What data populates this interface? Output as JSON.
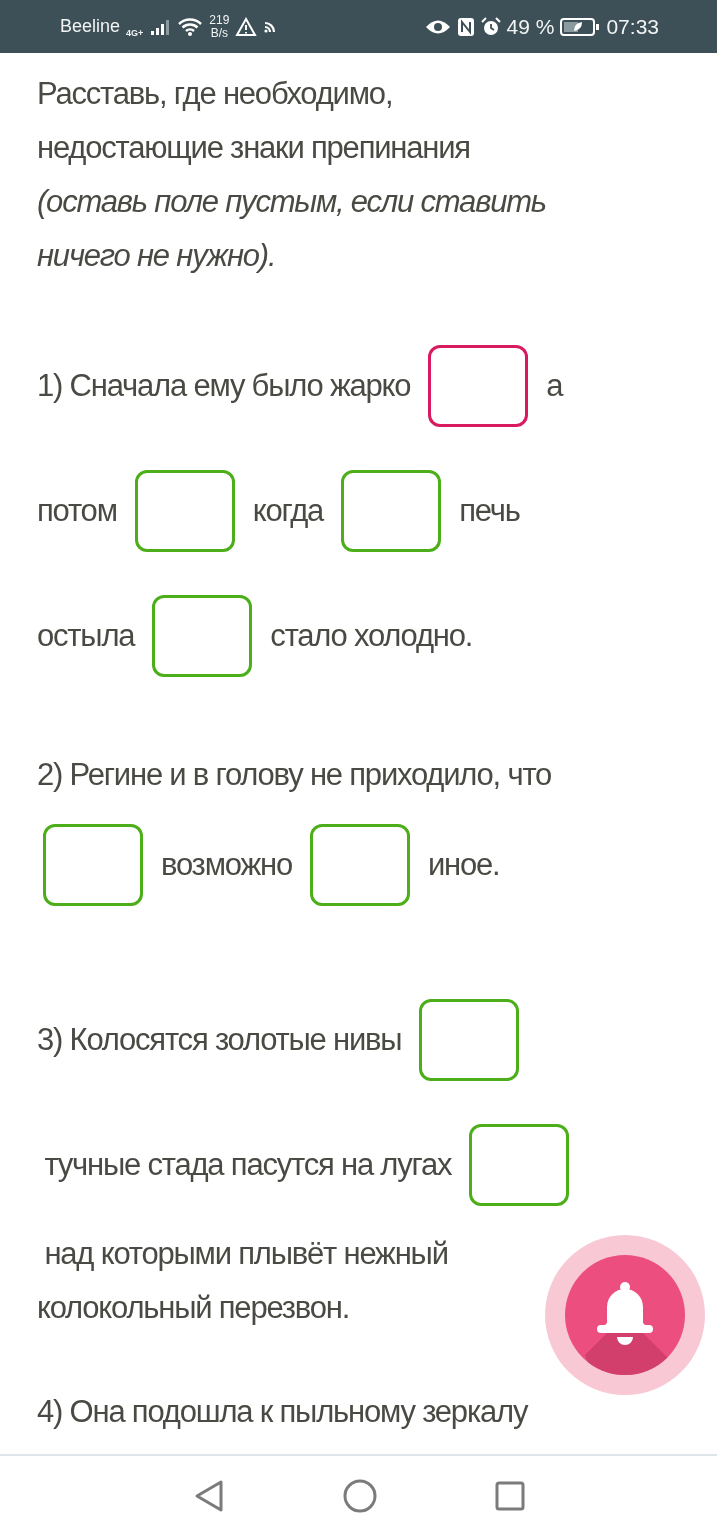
{
  "status_bar": {
    "carrier": "Beeline",
    "network": "4G+",
    "speed_value": "219",
    "speed_unit": "B/s",
    "battery": "49 %",
    "time": "07:33"
  },
  "instruction": {
    "text": "Расставь, где необходимо, недостающие знаки препинания",
    "note": "(оставь поле пустым, если ставить ничего не нужно)."
  },
  "questions": [
    {
      "lines": [
        [
          {
            "kind": "text",
            "text": "1) Сначала ему было жарко"
          },
          {
            "kind": "blank",
            "selected": true
          },
          {
            "kind": "text",
            "text": "а"
          }
        ],
        [
          {
            "kind": "text",
            "text": "потом"
          },
          {
            "kind": "blank",
            "selected": false
          },
          {
            "kind": "text",
            "text": "когда"
          },
          {
            "kind": "blank",
            "selected": false
          },
          {
            "kind": "text",
            "text": "печь"
          }
        ],
        [
          {
            "kind": "text",
            "text": "остыла"
          },
          {
            "kind": "blank",
            "selected": false
          },
          {
            "kind": "text",
            "text": "стало холодно."
          }
        ]
      ]
    },
    {
      "lines": [
        [
          {
            "kind": "text",
            "text": "2) Регине и в голову не приходило, что"
          }
        ],
        [
          {
            "kind": "blank",
            "selected": false
          },
          {
            "kind": "text",
            "text": "возможно"
          },
          {
            "kind": "blank",
            "selected": false
          },
          {
            "kind": "text",
            "text": "иное."
          }
        ]
      ]
    },
    {
      "lines": [
        [
          {
            "kind": "text",
            "text": "3) Колосятся золотые нивы"
          },
          {
            "kind": "blank",
            "selected": false
          }
        ],
        [
          {
            "kind": "text",
            "text": " тучные стада пасутся на лугах"
          },
          {
            "kind": "blank",
            "selected": false
          }
        ],
        [
          {
            "kind": "text",
            "text": " над которыми плывёт нежный"
          }
        ],
        [
          {
            "kind": "text",
            "text": "колокольный перезвон."
          }
        ]
      ]
    },
    {
      "lines": [
        [
          {
            "kind": "text",
            "text": "4) Она подошла к пыльному зеркалу"
          }
        ]
      ]
    }
  ]
}
